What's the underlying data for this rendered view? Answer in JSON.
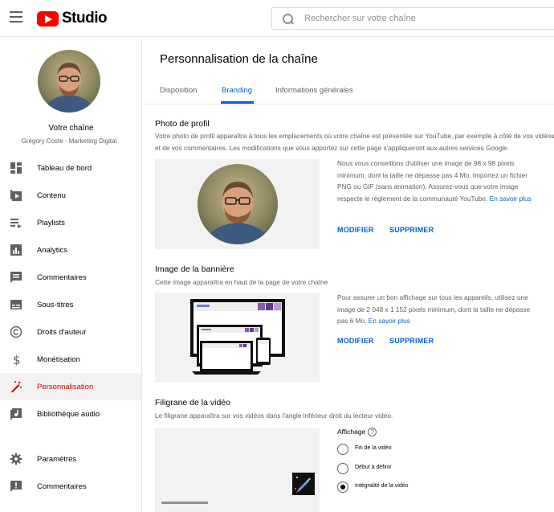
{
  "header": {
    "logo_text": "Studio",
    "search_placeholder": "Rechercher sur votre chaîne"
  },
  "sidebar": {
    "channel_title": "Votre chaîne",
    "channel_name": "Grégory Coste - Marketing Digital",
    "items": [
      {
        "label": "Tableau de bord",
        "icon": "dashboard-icon"
      },
      {
        "label": "Contenu",
        "icon": "content-icon"
      },
      {
        "label": "Playlists",
        "icon": "playlists-icon"
      },
      {
        "label": "Analytics",
        "icon": "analytics-icon"
      },
      {
        "label": "Commentaires",
        "icon": "comments-icon"
      },
      {
        "label": "Sous-titres",
        "icon": "subtitles-icon"
      },
      {
        "label": "Droits d'auteur",
        "icon": "copyright-icon"
      },
      {
        "label": "Monétisation",
        "icon": "dollar-icon"
      },
      {
        "label": "Personnalisation",
        "icon": "magic-wand-icon",
        "active": true
      },
      {
        "label": "Bibliothèque audio",
        "icon": "audio-library-icon"
      }
    ],
    "bottom_items": [
      {
        "label": "Paramètres",
        "icon": "gear-icon"
      },
      {
        "label": "Commentaires",
        "icon": "feedback-icon"
      }
    ]
  },
  "main": {
    "title": "Personnalisation de la chaîne",
    "tabs": [
      {
        "label": "Disposition",
        "active": false
      },
      {
        "label": "Branding",
        "active": true
      },
      {
        "label": "Informations générales",
        "active": false
      }
    ],
    "profile": {
      "title": "Photo de profil",
      "desc": "Votre photo de profil apparaîtra à tous les emplacements où votre chaîne est présentée sur YouTube, par exemple à côté de vos vidéos et de vos commentaires. Les modifications que vous apportez sur cette page s'appliqueront aux autres services Google.",
      "info": "Nous vous conseillons d'utiliser une image de 98 x 98 pixels minimum, dont la taille ne dépasse pas 4 Mo. Importez un fichier PNG ou GIF (sans animation). Assurez-vous que votre image respecte le règlement de la communauté YouTube.",
      "learn_more": "En savoir plus",
      "modify": "MODIFIER",
      "delete": "SUPPRIMER"
    },
    "banner": {
      "title": "Image de la bannière",
      "desc": "Cette image apparaîtra en haut de la page de votre chaîne",
      "info": "Pour assurer un bon affichage sur tous les appareils, utilisez une image de 2 048 x 1 152 pixels minimum, dont la taille ne dépasse pas 6 Mo.",
      "learn_more": "En savoir plus",
      "modify": "MODIFIER",
      "delete": "SUPPRIMER"
    },
    "watermark": {
      "title": "Filigrane de la vidéo",
      "desc": "Le filigrane apparaîtra sur vos vidéos dans l'angle inférieur droit du lecteur vidéo.",
      "display_label": "Affichage",
      "options": [
        {
          "label": "Fin de la vidéo",
          "checked": false
        },
        {
          "label": "Début à définir",
          "checked": false
        },
        {
          "label": "Intégralité de la vidéo",
          "checked": true
        }
      ]
    }
  },
  "colors": {
    "accent_blue": "#065fd4",
    "active_red": "#cc0000",
    "brand_red": "#ff0000"
  }
}
